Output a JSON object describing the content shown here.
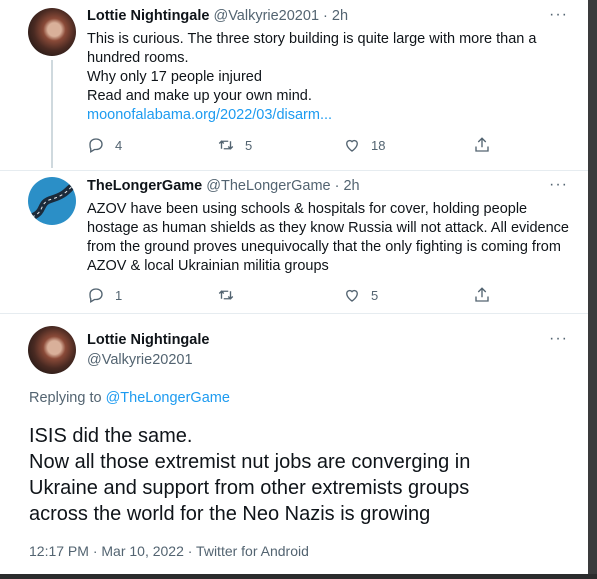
{
  "tweet1": {
    "name": "Lottie Nightingale",
    "handle": "@Valkyrie20201",
    "time": "· 2h",
    "more": "···",
    "lines": [
      "This is curious. The three story building is quite large with more than a",
      "hundred rooms.",
      "Why only 17 people injured",
      "Read and make up your own mind."
    ],
    "link": "moonofalabama.org/2022/03/disarm...",
    "replies": "4",
    "retweets": "5",
    "likes": "18"
  },
  "tweet2": {
    "name": "TheLongerGame",
    "handle": "@TheLongerGame",
    "time": "· 2h",
    "more": "···",
    "lines": [
      "AZOV have been using schools & hospitals for cover, holding people",
      "hostage as human shields as they know Russia will not attack. All evidence",
      "from the ground proves unequivocally that the only fighting is coming from",
      "AZOV & local Ukrainian militia groups"
    ],
    "replies": "1",
    "retweets": "",
    "likes": "5"
  },
  "main": {
    "name": "Lottie Nightingale",
    "handle": "@Valkyrie20201",
    "more": "···",
    "replying_prefix": "Replying to",
    "replying_handle": "@TheLongerGame",
    "lines": [
      "ISIS did the same.",
      "Now all those extremist nut jobs are converging in",
      "Ukraine and support from other extremists groups",
      "across the world for the Neo Nazis is growing"
    ],
    "timestamp": "12:17 PM · Mar 10, 2022 · Twitter for Android"
  },
  "colors": {
    "link": "#1d9bf0",
    "muted": "#536471",
    "text": "#0f1419"
  },
  "icons": [
    "reply-icon",
    "retweet-icon",
    "like-icon",
    "share-icon",
    "more-icon",
    "avatar"
  ]
}
